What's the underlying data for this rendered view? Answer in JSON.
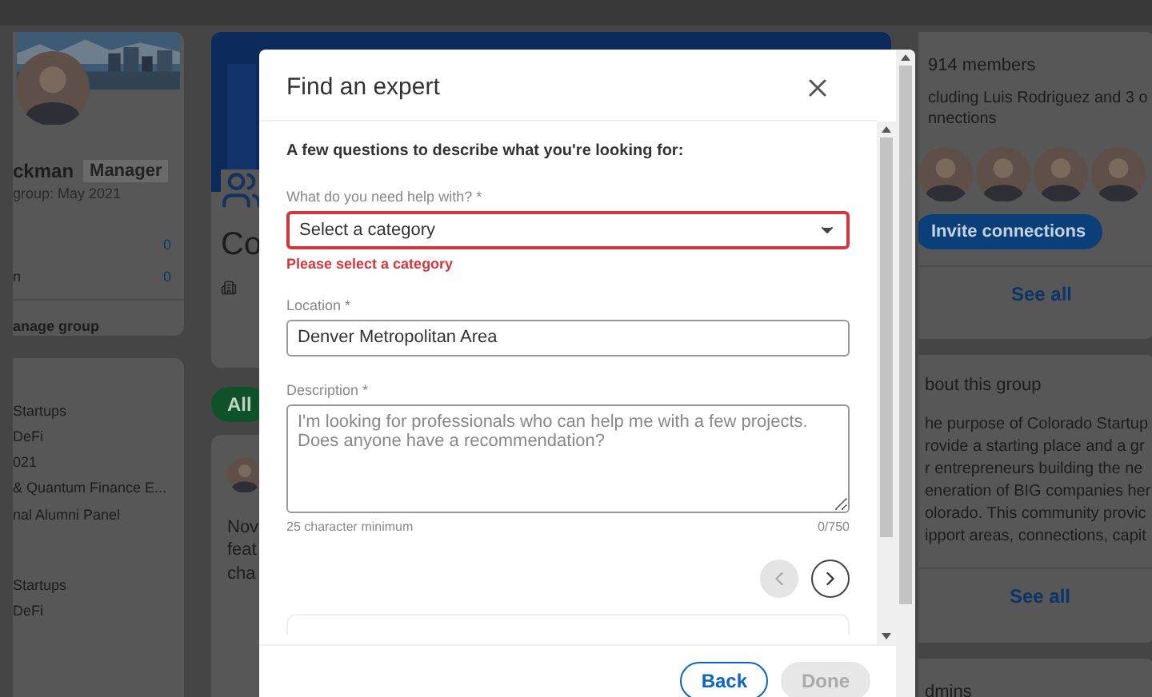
{
  "background": {
    "profile": {
      "name": "ckman",
      "badge": "Manager",
      "joined": "group: May 2021",
      "stats": [
        {
          "value": "0"
        },
        {
          "label": "n",
          "value": "0"
        }
      ],
      "action": "anage group"
    },
    "group_lists": [
      {
        "items": [
          "Startups",
          "DeFi",
          "021",
          "& Quantum Finance E...",
          "nal Alumni Panel"
        ]
      },
      {
        "items": [
          "Startups",
          "DeFi"
        ]
      }
    ],
    "group_header": {
      "title": "Co"
    },
    "filters": [
      {
        "label": "All",
        "selected": true
      }
    ],
    "post": {
      "lines": [
        "Nov",
        "feat",
        "cha"
      ]
    },
    "members": {
      "count": "914 members",
      "lines": [
        "cluding Luis Rodriguez and 3 o",
        "nnections"
      ],
      "invite": "Invite connections",
      "see_all": "See all"
    },
    "about": {
      "title": "bout this group",
      "lines": [
        "he purpose of Colorado Startup",
        "rovide a starting place and a gr",
        "r entrepreneurs building the ne",
        "eneration of BIG companies her",
        "olorado. This community provic",
        "ipport areas, connections, capit"
      ],
      "see_all": "See all"
    },
    "admins": {
      "title": "dmins"
    }
  },
  "dialog": {
    "title": "Find an expert",
    "intro": "A few questions to describe what you're looking for:",
    "fields": [
      {
        "kind": "select",
        "label": "What do you need help with? *",
        "value": "Select a category",
        "error": "Please select a category"
      },
      {
        "kind": "text",
        "label": "Location *",
        "value": "Denver Metropolitan Area"
      },
      {
        "kind": "textarea",
        "label": "Description *",
        "placeholder": "I'm looking for professionals who can help me with a few projects. Does anyone have a recommendation?",
        "hint": "25 character minimum",
        "counter": "0/750"
      }
    ],
    "pager": [
      {
        "kind": "prev",
        "disabled": true
      },
      {
        "kind": "next",
        "disabled": false
      }
    ],
    "buttons": [
      {
        "label": "Back",
        "disabled": false
      },
      {
        "label": "Done",
        "disabled": true
      }
    ]
  }
}
